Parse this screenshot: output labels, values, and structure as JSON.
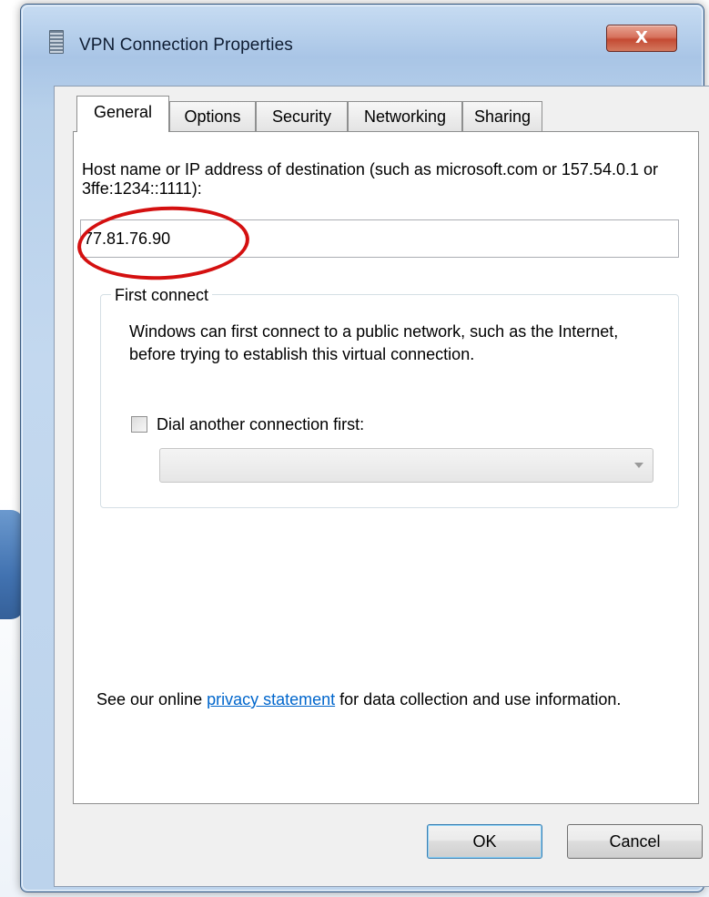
{
  "window": {
    "title": "VPN Connection Properties",
    "close_label": "X"
  },
  "tabs": [
    {
      "label": "General",
      "active": true
    },
    {
      "label": "Options",
      "active": false
    },
    {
      "label": "Security",
      "active": false
    },
    {
      "label": "Networking",
      "active": false
    },
    {
      "label": "Sharing",
      "active": false
    }
  ],
  "general": {
    "host_label": "Host name or IP address of destination (such as microsoft.com or 157.54.0.1 or 3ffe:1234::1111):",
    "host_value": "77.81.76.90",
    "first_connect": {
      "legend": "First connect",
      "description": "Windows can first connect to a public network, such as the Internet, before trying to establish this virtual connection.",
      "dial_label": "Dial another connection first:",
      "dial_checked": false,
      "dial_selected": ""
    },
    "privacy": {
      "prefix": "See our online ",
      "link_text": "privacy statement",
      "suffix": " for data collection and use information."
    }
  },
  "buttons": {
    "ok_label": "OK",
    "cancel_label": "Cancel"
  },
  "colors": {
    "annotation": "#d41010",
    "link": "#0066cc",
    "close_button": "#c44a33"
  }
}
